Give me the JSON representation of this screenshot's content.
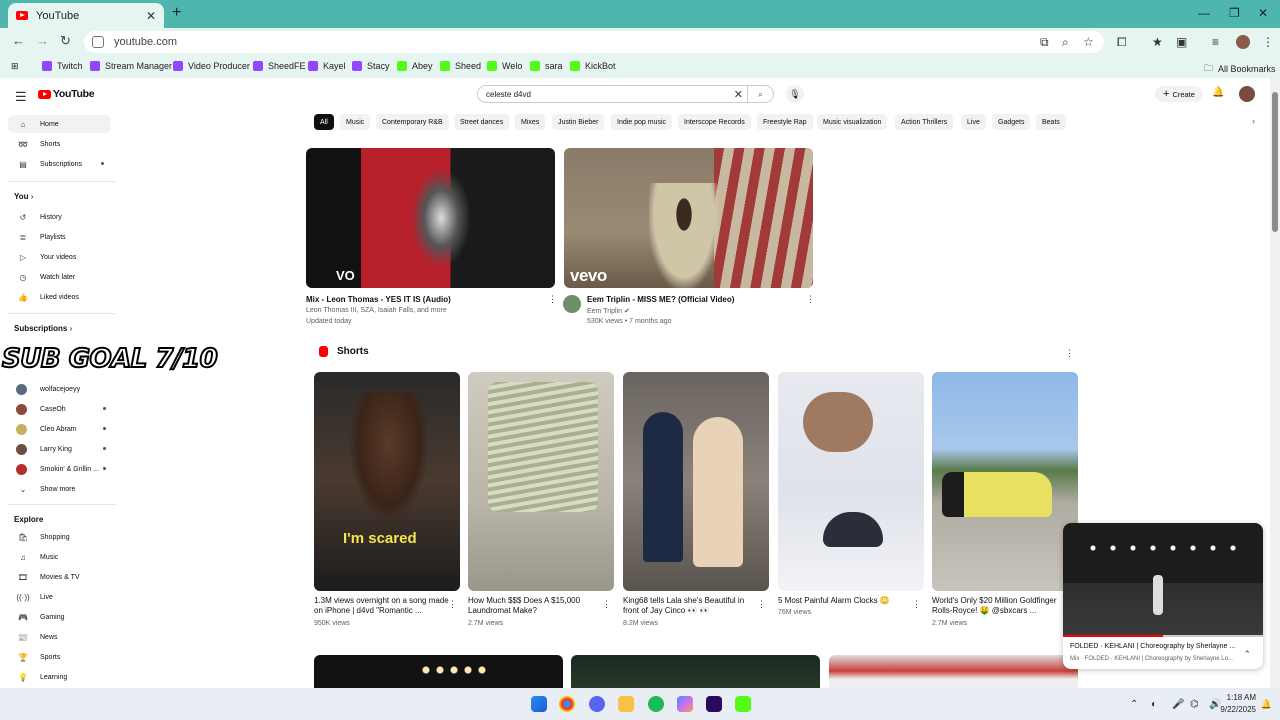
{
  "browser": {
    "tab_title": "YouTube",
    "tab_close": "✕",
    "new_tab": "+",
    "url": "youtube.com",
    "window_controls": [
      "—",
      "❐",
      "✕"
    ],
    "bookmarks": [
      {
        "label": "Twitch",
        "icon": "twitch-icon"
      },
      {
        "label": "Stream Manager",
        "icon": "twitch-icon"
      },
      {
        "label": "Video Producer",
        "icon": "twitch-icon"
      },
      {
        "label": "SheedFE",
        "icon": "twitch-icon"
      },
      {
        "label": "Kayel",
        "icon": "twitch-icon"
      },
      {
        "label": "Stacy",
        "icon": "twitch-icon"
      },
      {
        "label": "Abey",
        "icon": "kick-icon"
      },
      {
        "label": "Sheed",
        "icon": "kick-icon"
      },
      {
        "label": "Welo",
        "icon": "kick-icon"
      },
      {
        "label": "sara",
        "icon": "kick-icon"
      },
      {
        "label": "KickBot",
        "icon": "kick-icon"
      }
    ],
    "all_bookmarks": "All Bookmarks"
  },
  "youtube": {
    "logo_text": "YouTube",
    "search_value": "celeste d4vd",
    "create_label": "Create",
    "sidebar": {
      "main": [
        {
          "label": "Home",
          "icon": "home-icon",
          "active": true
        },
        {
          "label": "Shorts",
          "icon": "shorts-icon"
        },
        {
          "label": "Subscriptions",
          "icon": "subscriptions-icon"
        }
      ],
      "you_header": "You",
      "you": [
        {
          "label": "History",
          "icon": "history-icon"
        },
        {
          "label": "Playlists",
          "icon": "playlists-icon"
        },
        {
          "label": "Your videos",
          "icon": "your-videos-icon"
        },
        {
          "label": "Watch later",
          "icon": "watch-later-icon"
        },
        {
          "label": "Liked videos",
          "icon": "liked-icon"
        }
      ],
      "subscriptions_header": "Subscriptions",
      "subscriptions": [
        {
          "label": "wolfacejoeyy",
          "color": "#5a6a7a"
        },
        {
          "label": "CaseOh",
          "color": "#8b4a3a"
        },
        {
          "label": "Cleo Abram",
          "color": "#c8b060"
        },
        {
          "label": "Larry King",
          "color": "#6b5040"
        },
        {
          "label": "Smokin' & Grillin ...",
          "color": "#b03030"
        }
      ],
      "show_more": "Show more",
      "explore_header": "Explore",
      "explore": [
        {
          "label": "Shopping",
          "icon": "shopping-icon"
        },
        {
          "label": "Music",
          "icon": "music-icon"
        },
        {
          "label": "Movies & TV",
          "icon": "movies-icon"
        },
        {
          "label": "Live",
          "icon": "live-icon"
        },
        {
          "label": "Gaming",
          "icon": "gaming-icon"
        },
        {
          "label": "News",
          "icon": "news-icon"
        },
        {
          "label": "Sports",
          "icon": "sports-icon"
        },
        {
          "label": "Learning",
          "icon": "learning-icon"
        }
      ]
    },
    "overlay": "SUB GOAL 7/10",
    "chips": [
      "All",
      "Music",
      "Contemporary R&B",
      "Street dances",
      "Mixes",
      "Justin Bieber",
      "Indie pop music",
      "Interscope Records",
      "Freestyle Rap",
      "Music visualization",
      "Action Thrillers",
      "Live",
      "Gadgets",
      "Beats"
    ],
    "videos": [
      {
        "title": "Mix - Leon Thomas - YES IT IS (Audio)",
        "channel": "Leon Thomas III, SZA, Isaiah Falls, and more",
        "meta": "Updated today",
        "badge": "VO"
      },
      {
        "title": "Eem Triplin - MISS ME? (Official Video)",
        "channel": "Eem Triplin",
        "meta": "530K views • 7 months ago",
        "badge": "vevo"
      }
    ],
    "shorts_header": "Shorts",
    "shorts": [
      {
        "title": "1.3M views overnight on a song made on iPhone | d4vd \"Romantic ...",
        "views": "950K views",
        "caption": "I'm scared"
      },
      {
        "title": "How Much $$$ Does A $15,000 Laundromat Make?",
        "views": "2.7M views"
      },
      {
        "title": "King68 tells Lala she's Beautiful in front of Jay Cinco 👀 👀",
        "views": "8.2M views"
      },
      {
        "title": "5 Most Painful Alarm Clocks 😳",
        "views": "76M views"
      },
      {
        "title": "World's Only $20 Million Goldfinger Rolls-Royce! 🤑 @sbxcars ...",
        "views": "2.7M views"
      }
    ],
    "mini_player": {
      "title": "FOLDED · KEHLANI | Choreography by Sherlayne ...",
      "subtitle": "Mix · FOLDED · KEHLANI | Choreography by Sherlayne Lo...",
      "progress": 0.5
    }
  },
  "taskbar": {
    "time": "1:18 AM",
    "date": "9/22/2025"
  }
}
